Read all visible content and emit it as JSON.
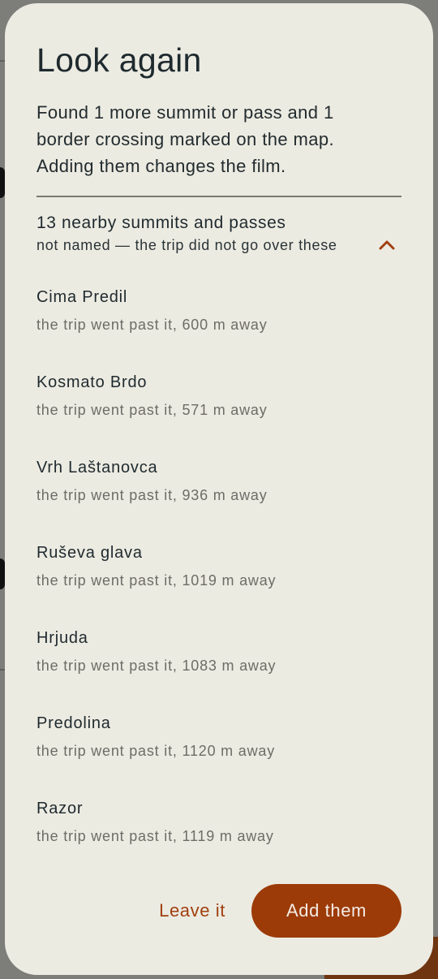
{
  "dialog": {
    "title": "Look again",
    "message": "Found 1 more summit or pass and 1 border crossing marked on the map. Adding them changes the film.",
    "section": {
      "title": "13 nearby summits and passes",
      "subtitle": "not named — the trip did not go over these",
      "toggle_icon": "chevron-up-icon",
      "expanded": true
    },
    "items": [
      {
        "name": "Cima Predil",
        "detail": "the trip went past it, 600 m away"
      },
      {
        "name": "Kosmato Brdo",
        "detail": "the trip went past it, 571 m away"
      },
      {
        "name": "Vrh Laštanovca",
        "detail": "the trip went past it, 936 m away"
      },
      {
        "name": "Ruševa glava",
        "detail": "the trip went past it, 1019 m away"
      },
      {
        "name": "Hrjuda",
        "detail": "the trip went past it, 1083 m away"
      },
      {
        "name": "Predolina",
        "detail": "the trip went past it, 1120 m away"
      },
      {
        "name": "Razor",
        "detail": "the trip went past it, 1119 m away"
      }
    ],
    "actions": {
      "leave_label": "Leave it",
      "add_label": "Add them"
    }
  },
  "colors": {
    "sheet": "#ecebe2",
    "accent": "#9c3b08",
    "text": "#1f2a2e",
    "muted": "#6d6c66"
  }
}
